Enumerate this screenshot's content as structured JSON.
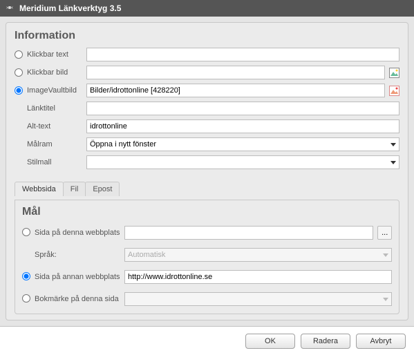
{
  "window": {
    "title": "Meridium Länkverktyg 3.5"
  },
  "information": {
    "heading": "Information",
    "radios": {
      "clickable_text": {
        "label": "Klickbar text",
        "value": ""
      },
      "clickable_image": {
        "label": "Klickbar bild",
        "value": ""
      },
      "imagevault": {
        "label": "ImageVaultbild",
        "value": "Bilder/idrottonline [428220]"
      }
    },
    "link_title": {
      "label": "Länktitel",
      "value": ""
    },
    "alt_text": {
      "label": "Alt-text",
      "value": "idrottonline"
    },
    "target_frame": {
      "label": "Målram",
      "value": "Öppna i nytt fönster"
    },
    "stylesheet": {
      "label": "Stilmall",
      "value": ""
    }
  },
  "tabs": {
    "web": "Webbsida",
    "file": "Fil",
    "email": "Epost"
  },
  "target": {
    "heading": "Mål",
    "site_this": {
      "label": "Sida på denna webbplats",
      "value": ""
    },
    "language": {
      "label": "Språk:",
      "value": "Automatisk"
    },
    "site_other": {
      "label": "Sida på annan webbplats",
      "value": "http://www.idrottonline.se"
    },
    "bookmark": {
      "label": "Bokmärke på denna sida",
      "value": ""
    },
    "browse": "..."
  },
  "buttons": {
    "ok": "OK",
    "delete": "Radera",
    "cancel": "Avbryt"
  }
}
